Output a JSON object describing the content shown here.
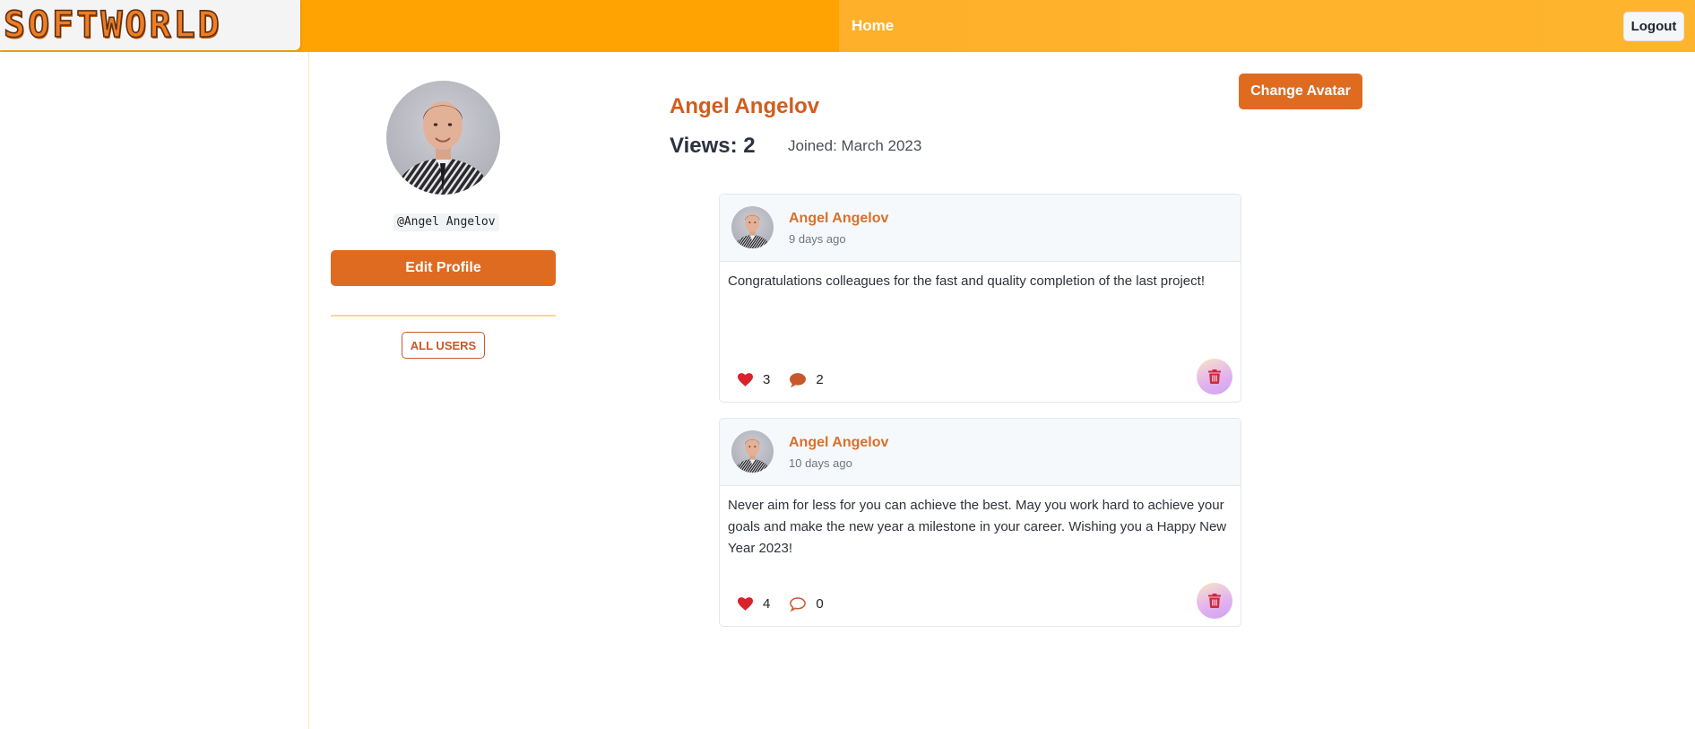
{
  "navbar": {
    "logo_text": "SOFTWORLD",
    "home_label": "Home",
    "logout_label": "Logout"
  },
  "sidebar": {
    "username": "@Angel Angelov",
    "edit_profile_label": "Edit Profile",
    "all_users_label": "ALL USERS"
  },
  "profile": {
    "name": "Angel Angelov",
    "views": "Views: 2",
    "joined": "Joined: March 2023",
    "change_avatar_label": "Change Avatar"
  },
  "posts": [
    {
      "author": "Angel Angelov",
      "time": "9 days ago",
      "text": "Congratulations colleagues for the fast and quality completion of the last project!",
      "likes": "3",
      "comments": "2",
      "comment_icon": "comment-filled-icon"
    },
    {
      "author": "Angel Angelov",
      "time": "10 days ago",
      "text": "Never aim for less for you can achieve the best. May you work hard to achieve your goals and make the new year a milestone in your career. Wishing you a Happy New Year 2023!",
      "likes": "4",
      "comments": "0",
      "comment_icon": "comment-outline-icon"
    }
  ],
  "colors": {
    "brand_orange": "#ffa302",
    "accent": "#df6b20",
    "name_orange": "#d05d1f",
    "heart_red": "#d8232a",
    "trash_red": "#d0283a"
  }
}
